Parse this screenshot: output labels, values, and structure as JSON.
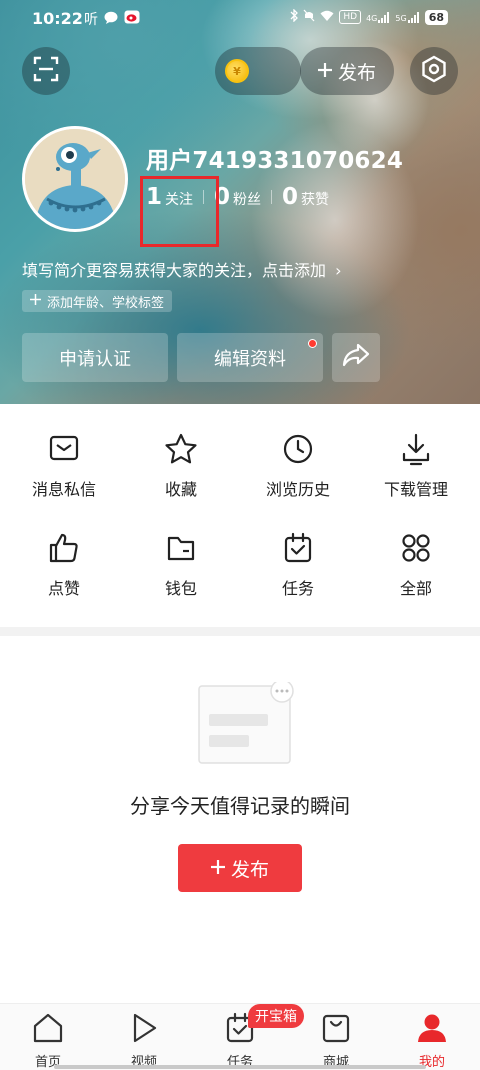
{
  "status_bar": {
    "time": "10:22",
    "left_icons": [
      "听",
      "chat-bubble-icon",
      "weibo-icon"
    ],
    "network": "HD",
    "signal1": "4G",
    "signal2": "5G",
    "battery": "68"
  },
  "header": {
    "publish_label": "发布",
    "coin_symbol": "¥"
  },
  "profile": {
    "username": "用户7419331070624",
    "following_count": "1",
    "following_label": "关注",
    "fans_count": "0",
    "fans_label": "粉丝",
    "likes_count": "0",
    "likes_label": "获赞",
    "bio": "填写简介更容易获得大家的关注，点击添加",
    "bio_arrow": "›",
    "tag_chip": "添加年龄、学校标签"
  },
  "actions": {
    "verify": "申请认证",
    "edit_profile": "编辑资料"
  },
  "grid": [
    {
      "label": "消息私信",
      "icon": "message-icon"
    },
    {
      "label": "收藏",
      "icon": "star-icon"
    },
    {
      "label": "浏览历史",
      "icon": "clock-icon"
    },
    {
      "label": "下载管理",
      "icon": "download-icon"
    },
    {
      "label": "点赞",
      "icon": "thumbs-up-icon"
    },
    {
      "label": "钱包",
      "icon": "wallet-icon"
    },
    {
      "label": "任务",
      "icon": "task-calendar-icon"
    },
    {
      "label": "全部",
      "icon": "all-grid-icon"
    }
  ],
  "empty_state": {
    "text": "分享今天值得记录的瞬间",
    "publish_label": "发布"
  },
  "bottom_nav": {
    "items": [
      {
        "label": "首页",
        "icon": "home-icon"
      },
      {
        "label": "视频",
        "icon": "play-icon"
      },
      {
        "label": "任务",
        "icon": "task-icon"
      },
      {
        "label": "商城",
        "icon": "shopping-bag-icon"
      },
      {
        "label": "我的",
        "icon": "person-icon"
      }
    ],
    "treasure_badge": "开宝箱",
    "active_index": 4
  },
  "colors": {
    "accent_red": "#ef3b3f",
    "highlight_box": "#e8282b"
  }
}
